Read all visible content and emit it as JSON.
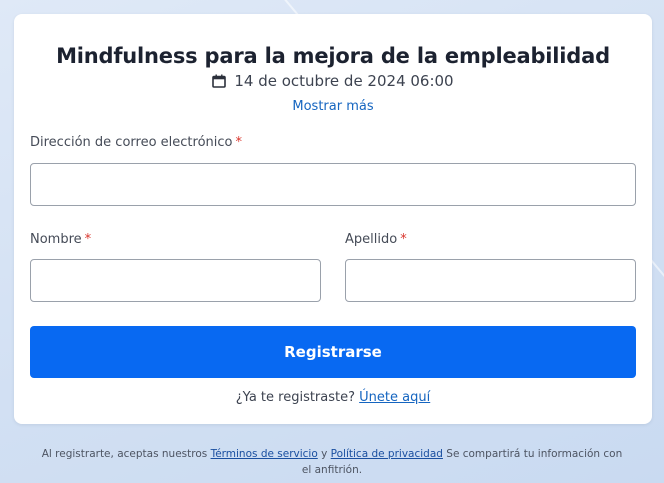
{
  "event": {
    "title": "Mindfulness para la mejora de la empleabilidad",
    "datetime": "14 de octubre de 2024 06:00",
    "show_more": "Mostrar más"
  },
  "form": {
    "email_label": "Dirección de correo electrónico",
    "first_name_label": "Nombre",
    "last_name_label": "Apellido",
    "required_mark": "*",
    "email_value": "",
    "first_name_value": "",
    "last_name_value": "",
    "submit_label": "Registrarse"
  },
  "login": {
    "prompt": "¿Ya te registraste?",
    "link": "Únete aquí"
  },
  "footer": {
    "text_before": "Al registrarte, aceptas nuestros ",
    "terms_link": "Términos de servicio",
    "and": " y ",
    "privacy_link": "Política de privacidad",
    "text_after": " Se compartirá tu información con el anfitrión."
  },
  "icons": {
    "calendar": "calendar-icon"
  },
  "colors": {
    "primary": "#0869f2",
    "link": "#1565c0",
    "required": "#d9342b"
  }
}
